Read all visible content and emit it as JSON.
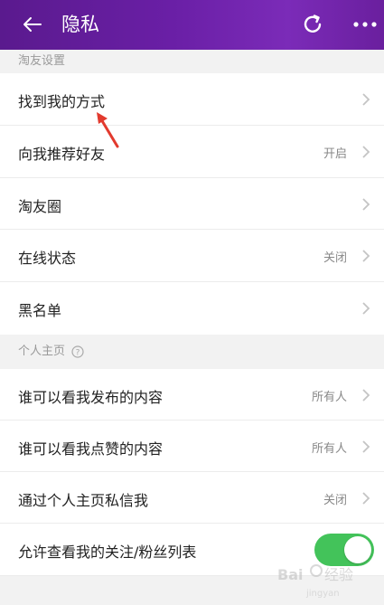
{
  "header": {
    "title": "隐私",
    "back_icon": "arrow-left-icon",
    "refresh_icon": "refresh-icon",
    "more_icon": "more-dots-icon"
  },
  "sections": {
    "friends": "淘友设置",
    "profile": "个人主页"
  },
  "rows": {
    "find_me": {
      "label": "找到我的方式",
      "value": ""
    },
    "recommend": {
      "label": "向我推荐好友",
      "value": "开启"
    },
    "circle": {
      "label": "淘友圈",
      "value": ""
    },
    "online": {
      "label": "在线状态",
      "value": "关闭"
    },
    "blacklist": {
      "label": "黑名单",
      "value": ""
    },
    "who_posts": {
      "label": "谁可以看我发布的内容",
      "value": "所有人"
    },
    "who_likes": {
      "label": "谁可以看我点赞的内容",
      "value": "所有人"
    },
    "dm": {
      "label": "通过个人主页私信我",
      "value": "关闭"
    },
    "follow_list": {
      "label": "允许查看我的关注/粉丝列表",
      "toggle_on": true
    }
  },
  "watermark": "Baidu经验",
  "colors": {
    "header": "#6a1fa6",
    "toggle_on": "#43c35a",
    "annotation_arrow": "#e23a2e"
  }
}
